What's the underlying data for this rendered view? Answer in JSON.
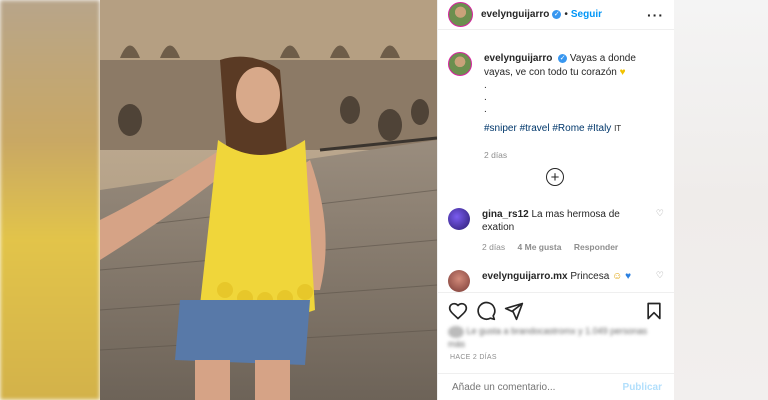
{
  "header": {
    "username": "evelynguijarro",
    "follow_label": "Seguir",
    "separator": "•"
  },
  "caption": {
    "username": "evelynguijarro",
    "text": "Vayas a donde vayas, ve con todo tu corazón",
    "dots": [
      ".",
      ".",
      "."
    ],
    "hashtags": "#sniper #travel #Rome #Italy",
    "hashtag_suffix": "IT",
    "time": "2 días"
  },
  "comments": [
    {
      "username": "gina_rs12",
      "text": "La mas hermosa de exation",
      "time": "2 días",
      "likes": "4 Me gusta",
      "reply_label": "Responder"
    },
    {
      "username": "evelynguijarro.mx",
      "text": "Princesa"
    }
  ],
  "likes_text": "Le gusta a brandocastromx y 1.049 personas más",
  "time_ago": "HACE 2 DÍAS",
  "add_comment": {
    "placeholder": "Añade un comentario...",
    "post_label": "Publicar"
  },
  "colors": {
    "accent": "#0095f6",
    "verified": "#3897f0",
    "post_disabled": "#b2dffc"
  }
}
